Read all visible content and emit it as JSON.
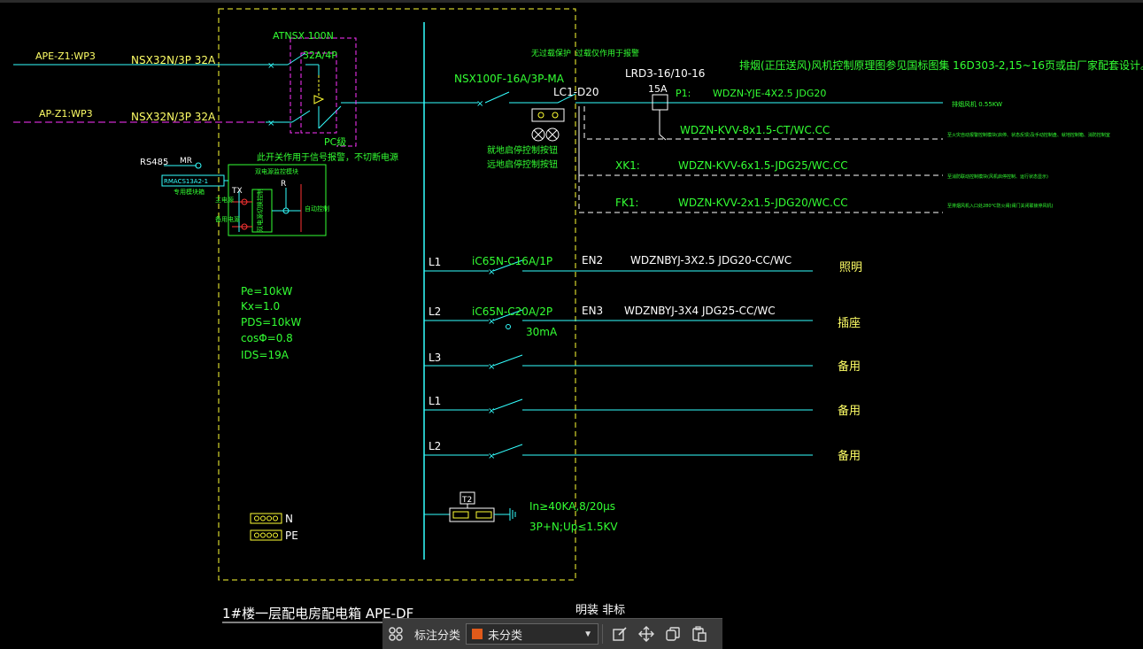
{
  "colors": {
    "bus": "#33ffff",
    "frame": "#ffff33",
    "magenta": "#ff33ff",
    "green": "#33ff33",
    "red": "#ff3333",
    "white": "#ffffff",
    "yellow_text": "#ffff66",
    "swatch": "#e05a1a"
  },
  "inputs": {
    "ape_label": "APE-Z1:WP3",
    "ap_label": "AP-Z1:WP3",
    "ape_breaker": "NSX32N/3P 32A",
    "ap_breaker": "NSX32N/3P 32A"
  },
  "ats": {
    "model": "ATNSX 100N",
    "rating": "32A/4P",
    "pc_label": "PC级",
    "note": "此开关作用于信号报警，不切断电源"
  },
  "rs485": {
    "label": "RS485",
    "mr": "MR",
    "module": "RMACS13A2-1",
    "module_note": "专用模块箱",
    "box_title": "双电源监控模块",
    "tx": "TX",
    "r": "R",
    "left_a": "主电源",
    "left_b": "备用电源",
    "relay": "双电源切换控制",
    "right_note": "自动控制"
  },
  "load_params": {
    "pe": "Pe=10kW",
    "kx": "Kx=1.0",
    "pds": "PDS=10kW",
    "cos": "cosΦ=0.8",
    "ids": "IDS=19A"
  },
  "fan": {
    "note_top_a": "无过载保护",
    "note_top_b": "过载仅作用于报警",
    "breaker": "NSX100F-16A/3P-MA",
    "contactor": "LC1-D20",
    "relay": "LRD3-16/10-16",
    "relay_set": "15A",
    "local_a": "就地启停控制按钮",
    "local_b": "远地启停控制按钮",
    "title": "排烟(正压送风)风机控制原理图参见国标图集 16D303-2,15~16页或由厂家配套设计。",
    "p1_label": "P1:",
    "p1_cable": "WDZN-YJE-4X2.5  JDG20",
    "p1_dest": "排烟风机 0.55KW",
    "c2_cable": "WDZN-KVV-8x1.5-CT/WC.CC",
    "c2_dest": "至火灾自动报警控制模块(启停、状态反馈)及手动控制盘、就地控制箱、消防控制室",
    "xk_label": "XK1:",
    "xk_cable": "WDZN-KVV-6x1.5-JDG25/WC.CC",
    "xk_dest": "至消防联动控制模块(风机启停控制、运行状态显示)",
    "fk_label": "FK1:",
    "fk_cable": "WDZN-KVV-2x1.5-JDG20/WC.CC",
    "fk_dest": "至排烟风机入口处280°C防火阀(阀门关闭联锁停风机)"
  },
  "circuits": [
    {
      "phase": "L1",
      "breaker": "iC65N-C16A/1P",
      "name": "EN2",
      "cable": "WDZNBYJ-3X2.5  JDG20-CC/WC",
      "dest": "照明",
      "rcd": ""
    },
    {
      "phase": "L2",
      "breaker": "iC65N-C20A/2P",
      "name": "EN3",
      "cable": "WDZNBYJ-3X4  JDG25-CC/WC",
      "dest": "插座",
      "rcd": "30mA"
    },
    {
      "phase": "L3",
      "breaker": "",
      "name": "",
      "cable": "",
      "dest": "备用",
      "rcd": ""
    },
    {
      "phase": "L1",
      "breaker": "",
      "name": "",
      "cable": "",
      "dest": "备用",
      "rcd": ""
    },
    {
      "phase": "L2",
      "breaker": "",
      "name": "",
      "cable": "",
      "dest": "备用",
      "rcd": ""
    }
  ],
  "spd": {
    "tag": "T2",
    "spec_a": "In≥40KA,8/20μs",
    "spec_b": "3P+N;Up≤1.5KV"
  },
  "terminals": {
    "n": "N",
    "pe": "PE"
  },
  "panel_title": "1#楼一层配电房配电箱 APE-DF",
  "install_note": "明装 非标",
  "toolbar": {
    "category_label": "标注分类",
    "category_value": "未分类"
  }
}
